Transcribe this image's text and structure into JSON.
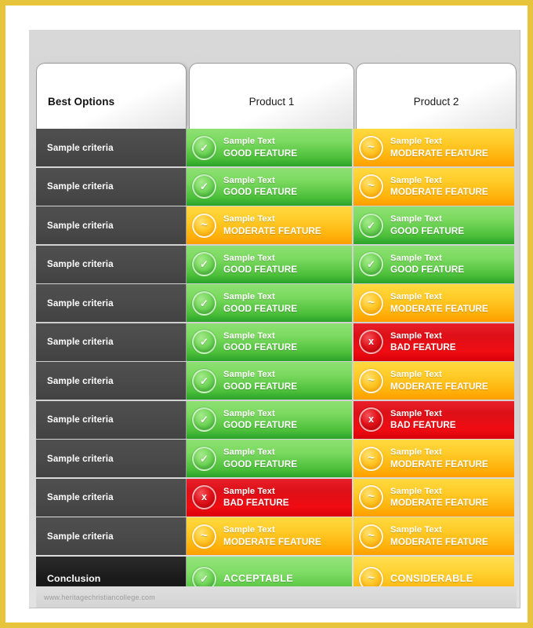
{
  "frame": {
    "border_color": "#e6c43c",
    "background": "#ffffff"
  },
  "table": {
    "header": {
      "criteria_label": "Best Options",
      "columns": [
        "Product 1",
        "Product 2"
      ]
    },
    "legend_colors": {
      "good": "#4cbf3a",
      "moderate": "#ffaf09",
      "bad": "#e8202a",
      "criteria_bg": "#4a4a4a",
      "conclusion_bg": "#1a1a1a"
    },
    "icons": {
      "good": "check-icon",
      "moderate": "tilde-icon",
      "bad": "x-icon"
    },
    "glyphs": {
      "good": "✓",
      "moderate": "~",
      "bad": "x"
    },
    "rows": [
      {
        "criteria": "Sample criteria",
        "product1": {
          "status": "good",
          "line1": "Sample Text",
          "line2": "GOOD FEATURE"
        },
        "product2": {
          "status": "moderate",
          "line1": "Sample Text",
          "line2": "MODERATE FEATURE"
        }
      },
      {
        "criteria": "Sample criteria",
        "product1": {
          "status": "good",
          "line1": "Sample Text",
          "line2": "GOOD FEATURE"
        },
        "product2": {
          "status": "moderate",
          "line1": "Sample Text",
          "line2": "MODERATE FEATURE"
        }
      },
      {
        "criteria": "Sample criteria",
        "product1": {
          "status": "moderate",
          "line1": "Sample Text",
          "line2": "MODERATE FEATURE"
        },
        "product2": {
          "status": "good",
          "line1": "Sample Text",
          "line2": "GOOD FEATURE"
        }
      },
      {
        "criteria": "Sample criteria",
        "product1": {
          "status": "good",
          "line1": "Sample Text",
          "line2": "GOOD FEATURE"
        },
        "product2": {
          "status": "good",
          "line1": "Sample Text",
          "line2": "GOOD FEATURE"
        }
      },
      {
        "criteria": "Sample criteria",
        "product1": {
          "status": "good",
          "line1": "Sample Text",
          "line2": "GOOD FEATURE"
        },
        "product2": {
          "status": "moderate",
          "line1": "Sample Text",
          "line2": "MODERATE FEATURE"
        }
      },
      {
        "criteria": "Sample criteria",
        "product1": {
          "status": "good",
          "line1": "Sample Text",
          "line2": "GOOD FEATURE"
        },
        "product2": {
          "status": "bad",
          "line1": "Sample Text",
          "line2": "BAD FEATURE"
        }
      },
      {
        "criteria": "Sample criteria",
        "product1": {
          "status": "good",
          "line1": "Sample Text",
          "line2": "GOOD FEATURE"
        },
        "product2": {
          "status": "moderate",
          "line1": "Sample Text",
          "line2": "MODERATE FEATURE"
        }
      },
      {
        "criteria": "Sample criteria",
        "product1": {
          "status": "good",
          "line1": "Sample Text",
          "line2": "GOOD FEATURE"
        },
        "product2": {
          "status": "bad",
          "line1": "Sample Text",
          "line2": "BAD FEATURE"
        }
      },
      {
        "criteria": "Sample criteria",
        "product1": {
          "status": "good",
          "line1": "Sample Text",
          "line2": "GOOD FEATURE"
        },
        "product2": {
          "status": "moderate",
          "line1": "Sample Text",
          "line2": "MODERATE FEATURE"
        }
      },
      {
        "criteria": "Sample criteria",
        "product1": {
          "status": "bad",
          "line1": "Sample Text",
          "line2": "BAD FEATURE"
        },
        "product2": {
          "status": "moderate",
          "line1": "Sample Text",
          "line2": "MODERATE FEATURE"
        }
      },
      {
        "criteria": "Sample criteria",
        "product1": {
          "status": "moderate",
          "line1": "Sample Text",
          "line2": "MODERATE FEATURE"
        },
        "product2": {
          "status": "moderate",
          "line1": "Sample Text",
          "line2": "MODERATE FEATURE"
        }
      }
    ],
    "conclusion": {
      "criteria": "Conclusion",
      "product1": {
        "status": "good",
        "line2": "ACCEPTABLE"
      },
      "product2": {
        "status": "moderate",
        "line2": "CONSIDERABLE"
      }
    },
    "watermark": "www.heritagechristiancollege.com"
  }
}
